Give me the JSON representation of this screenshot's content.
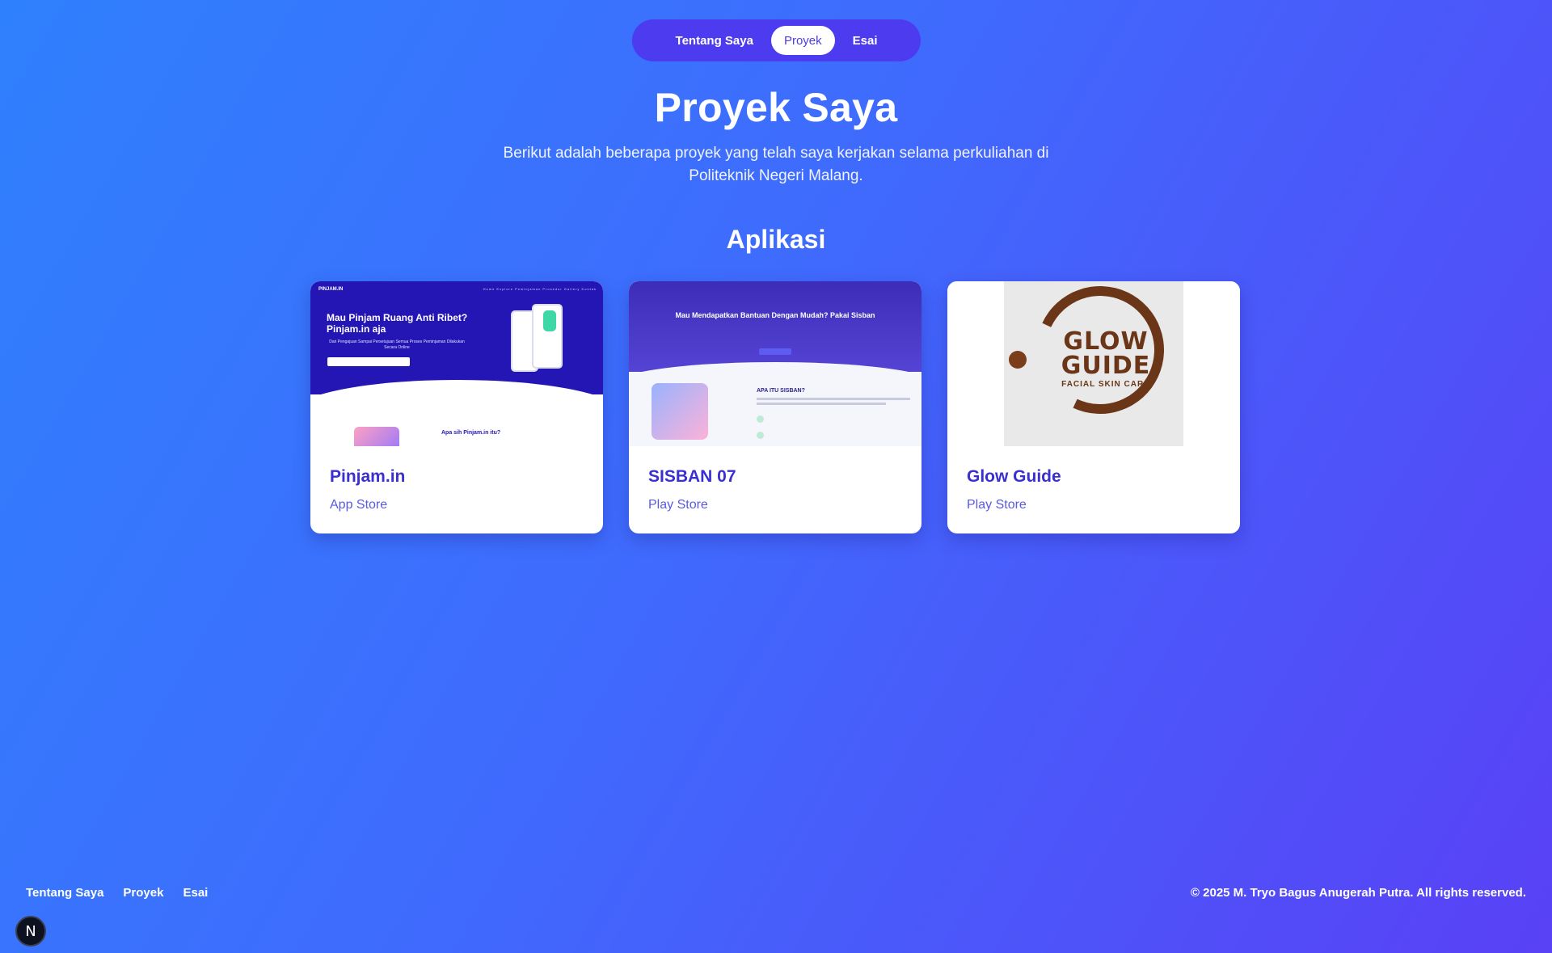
{
  "nav": {
    "items": [
      {
        "label": "Tentang Saya",
        "active": false
      },
      {
        "label": "Proyek",
        "active": true
      },
      {
        "label": "Esai",
        "active": false
      }
    ]
  },
  "hero": {
    "title": "Proyek Saya",
    "subtitle": "Berikut adalah beberapa proyek yang telah saya kerjakan selama perkuliahan di Politeknik Negeri Malang."
  },
  "section": {
    "title": "Aplikasi"
  },
  "projects": [
    {
      "title": "Pinjam.in",
      "link": "App Store",
      "thumb": {
        "logo": "PINJAM.IN",
        "menu": "Home Explore Peminjaman Prosedur Gallery Kontak",
        "headline": "Mau Pinjam Ruang Anti Ribet? Pinjam.in aja",
        "tagline": "Dari Pengajuan Sampai Persetujuan Semua Proses Peminjaman Dilakukan Secara Online",
        "section_heading": "Apa sih Pinjam.in itu?"
      }
    },
    {
      "title": "SISBAN 07",
      "link": "Play Store",
      "thumb": {
        "headline": "Mau Mendapatkan Bantuan Dengan Mudah? Pakai Sisban",
        "section_heading": "APA ITU SISBAN?"
      }
    },
    {
      "title": "Glow Guide",
      "link": "Play Store",
      "thumb": {
        "logo_text": "GLOW GUIDE",
        "logo_tagline": "FACIAL SKIN CARE"
      }
    }
  ],
  "footer": {
    "links": [
      "Tentang Saya",
      "Proyek",
      "Esai"
    ],
    "copyright": "© 2025 M. Tryo Bagus Anugerah Putra. All rights reserved."
  },
  "badge": {
    "letter": "N",
    "icon": "nextjs-icon"
  }
}
